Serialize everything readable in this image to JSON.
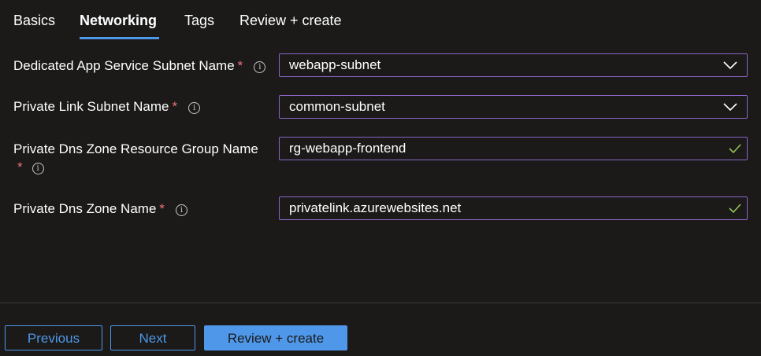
{
  "tabs": [
    {
      "label": "Basics",
      "active": false
    },
    {
      "label": "Networking",
      "active": true
    },
    {
      "label": "Tags",
      "active": false
    },
    {
      "label": "Review + create",
      "active": false
    }
  ],
  "form": {
    "subnet": {
      "label": "Dedicated App Service Subnet Name",
      "required_mark": "*",
      "value": "webapp-subnet",
      "control": "dropdown"
    },
    "private_link": {
      "label": "Private Link Subnet Name",
      "required_mark": "*",
      "value": "common-subnet",
      "control": "dropdown"
    },
    "dns_rg": {
      "label": "Private Dns Zone Resource Group Name",
      "required_mark": "*",
      "value": "rg-webapp-frontend",
      "control": "textbox-validated"
    },
    "dns_zone": {
      "label": "Private Dns Zone Name",
      "required_mark": "*",
      "value": "privatelink.azurewebsites.net",
      "control": "textbox-validated"
    }
  },
  "footer": {
    "previous_label": "Previous",
    "next_label": "Next",
    "review_label": "Review + create"
  },
  "colors": {
    "background": "#1b1a19",
    "accent": "#4f97e8",
    "field_border": "#8a65c7",
    "required": "#f1707b",
    "valid_check": "#92c353"
  }
}
